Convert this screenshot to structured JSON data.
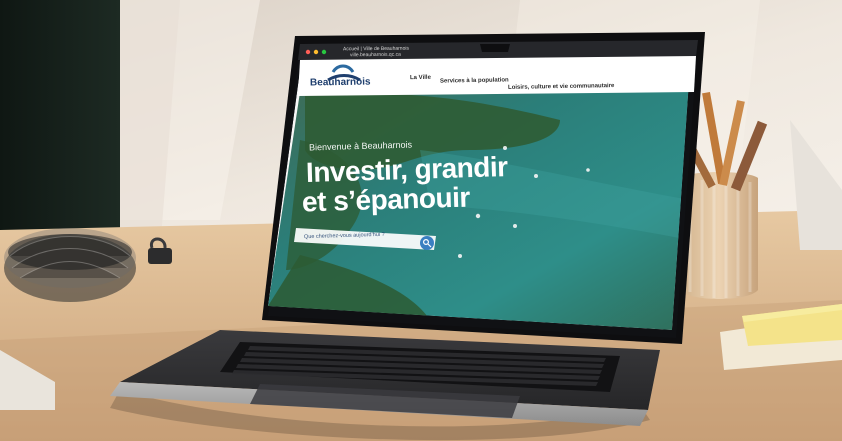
{
  "browser": {
    "tab_title": "Accueil | Ville de Beauharnois",
    "url": "ville.beauharnois.qc.ca"
  },
  "site": {
    "logo_text": "Beauharnois",
    "nav": [
      {
        "label": "La Ville"
      },
      {
        "label": "Services à la population"
      },
      {
        "label": "Loisirs, culture et vie communautaire"
      }
    ],
    "hero": {
      "kicker": "Bienvenue à Beauharnois",
      "title_line1": "Investir, grandir",
      "title_line2": "et s’épanouir",
      "search_placeholder": "Que cherchez-vous aujourd’hui ?"
    }
  },
  "colors": {
    "navy": "#1f3f6e",
    "accent_blue": "#3a7fc1",
    "water": "#2f8a86",
    "wood": "#d7b48a",
    "wall": "#efe8df"
  }
}
